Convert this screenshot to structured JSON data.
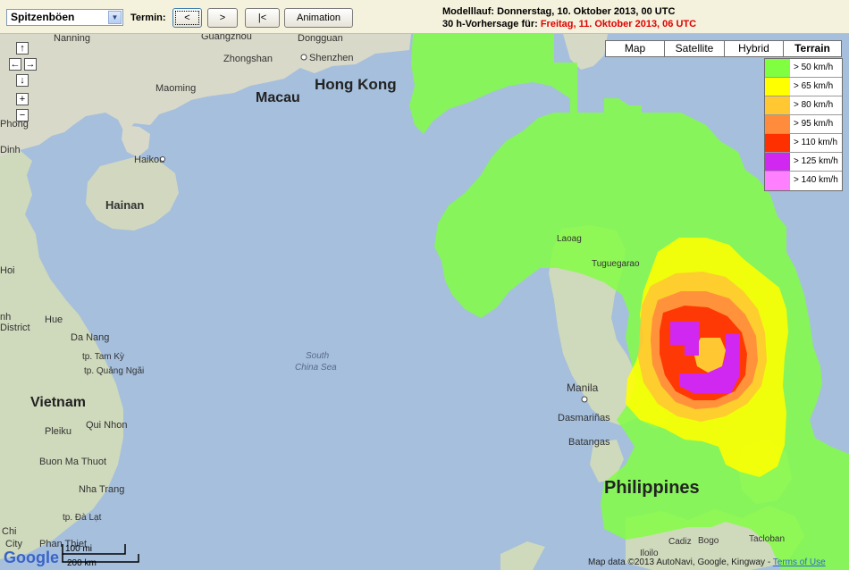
{
  "toolbar": {
    "selection": "Spitzenböen",
    "termin_label": "Termin:",
    "prev_label": "<",
    "next_label": ">",
    "first_label": "|<",
    "animation_label": "Animation",
    "modelllauf": "Modelllauf: Donnerstag, 10. Oktober 2013, 00 UTC",
    "forecast_prefix": "30 h-Vorhersage für: ",
    "forecast_time": "Freitag, 11. Oktober 2013, 06 UTC"
  },
  "nav": {
    "up": "↑",
    "left": "←",
    "right": "→",
    "down": "↓",
    "zoom_in": "+",
    "zoom_out": "−"
  },
  "map_types": [
    {
      "label": "Map",
      "selected": false
    },
    {
      "label": "Satellite",
      "selected": false
    },
    {
      "label": "Hybrid",
      "selected": false
    },
    {
      "label": "Terrain",
      "selected": true
    }
  ],
  "legend": [
    {
      "label": "> 50 km/h",
      "color": "#80ff40"
    },
    {
      "label": "> 65 km/h",
      "color": "#ffff00"
    },
    {
      "label": "> 80 km/h",
      "color": "#ffc832"
    },
    {
      "label": "> 95 km/h",
      "color": "#ff8c3c"
    },
    {
      "label": "> 110 km/h",
      "color": "#ff3000"
    },
    {
      "label": "> 125 km/h",
      "color": "#d028f0"
    },
    {
      "label": "> 140 km/h",
      "color": "#ff80ff"
    }
  ],
  "places": {
    "nanning": "Nanning",
    "guangzhou": "Guangzhou",
    "dongguan": "Dongguan",
    "zhongshan": "Zhongshan",
    "shenzhen": "Shenzhen",
    "maoming": "Maoming",
    "macau": "Macau",
    "hong_kong": "Hong Kong",
    "phong": "Phong",
    "dinh": "Dinh",
    "haikou": "Haikou",
    "hainan": "Hainan",
    "hoi": "Hoi",
    "nh": "nh",
    "hue": "Hue",
    "district": "District",
    "da_nang": "Da Nang",
    "tam_ky": "tp. Tam Kỳ",
    "quang_ngai": "tp. Quảng Ngãi",
    "vietnam": "Vietnam",
    "qui_nhon": "Qui Nhon",
    "pleiku": "Pleiku",
    "buon_ma_thuot": "Buon Ma Thuot",
    "nha_trang": "Nha Trang",
    "da_lat": "tp. Đà Lạt",
    "chi": "Chi",
    "city": "City",
    "phan_thiet": "Phan Thiet",
    "south_china_sea": "South",
    "south_china_sea2": "China Sea",
    "laoag": "Laoag",
    "tuguegarao": "Tuguegarao",
    "manila": "Manila",
    "dasmarinas": "Dasmariñas",
    "batangas": "Batangas",
    "philippines": "Philippines",
    "iloilo": "Iloilo",
    "cadiz": "Cadiz",
    "bogo": "Bogo",
    "tacloban": "Tacloban"
  },
  "scale": {
    "top": "100 mi",
    "bottom": "200 km"
  },
  "google_logo": "Google",
  "credit": "Map data ©2013 AutoNavi, Google, Kingway - ",
  "terms": "Terms of Use"
}
